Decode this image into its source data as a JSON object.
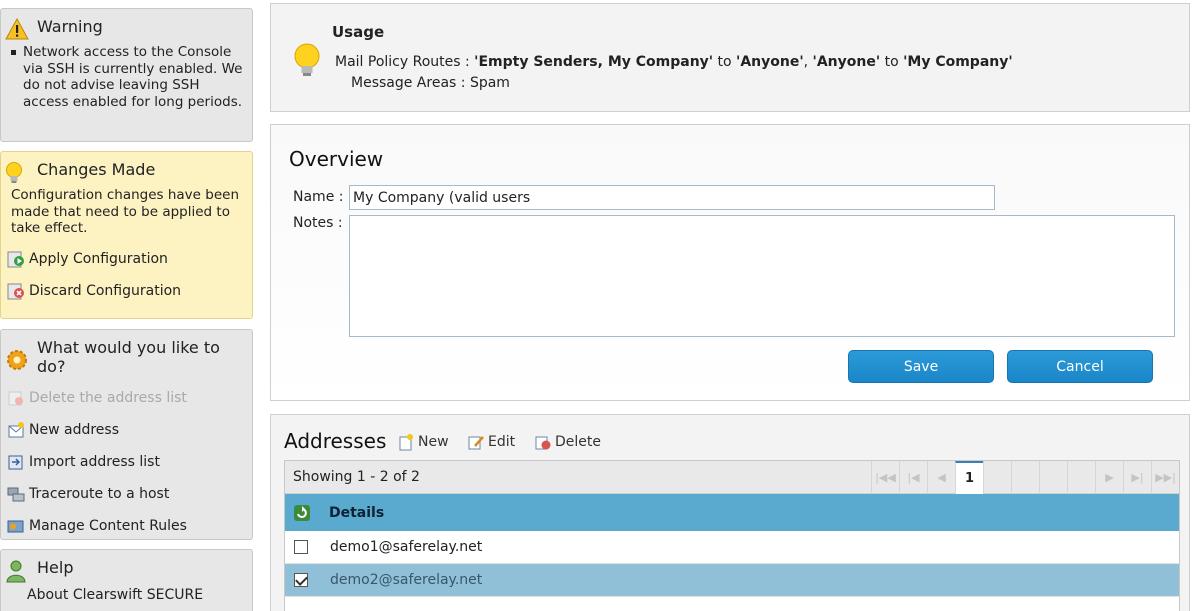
{
  "sidebar": {
    "warning": {
      "title": "Warning",
      "text": "Network access to the Console via SSH is currently enabled. We do not advise leaving SSH access enabled for long periods."
    },
    "changes": {
      "title": "Changes Made",
      "text": "Configuration changes have been made that need to be applied to take effect.",
      "apply": "Apply Configuration",
      "discard": "Discard Configuration"
    },
    "actions": {
      "title": "What would you like to do?",
      "items": [
        {
          "label": "Delete the address list",
          "icon": "delete-list-icon",
          "disabled": true
        },
        {
          "label": "New address",
          "icon": "new-address-icon"
        },
        {
          "label": "Import address list",
          "icon": "import-icon"
        },
        {
          "label": "Traceroute to a host",
          "icon": "traceroute-icon"
        },
        {
          "label": "Manage Content Rules",
          "icon": "content-rules-icon"
        }
      ]
    },
    "help": {
      "title": "Help",
      "item": "About Clearswift SECURE"
    }
  },
  "usage": {
    "title": "Usage",
    "routes_label": "Mail Policy Routes :",
    "route1_from": "'Empty Senders, My Company'",
    "to1": "to",
    "route1_to": "'Anyone'",
    "sep": ",",
    "route2_from": "'Anyone'",
    "to2": "to",
    "route2_to": "'My Company'",
    "areas_label": "Message Areas :",
    "areas_value": "Spam"
  },
  "overview": {
    "title": "Overview",
    "name_label": "Name :",
    "name_value": "My Company (valid users",
    "notes_label": "Notes :",
    "notes_value": "",
    "save": "Save",
    "cancel": "Cancel"
  },
  "addresses": {
    "title": "Addresses",
    "new": "New",
    "edit": "Edit",
    "delete": "Delete",
    "showing": "Showing 1 - 2 of 2",
    "current_page": "1",
    "column": "Details",
    "rows": [
      {
        "value": "demo1@saferelay.net",
        "checked": false
      },
      {
        "value": "demo2@saferelay.net",
        "checked": true
      }
    ]
  },
  "colors": {
    "accent": "#1a86c8",
    "grid_header": "#5aa9cf",
    "selected_row": "#8fc0d8",
    "changes_bg": "#fdf3c2"
  }
}
